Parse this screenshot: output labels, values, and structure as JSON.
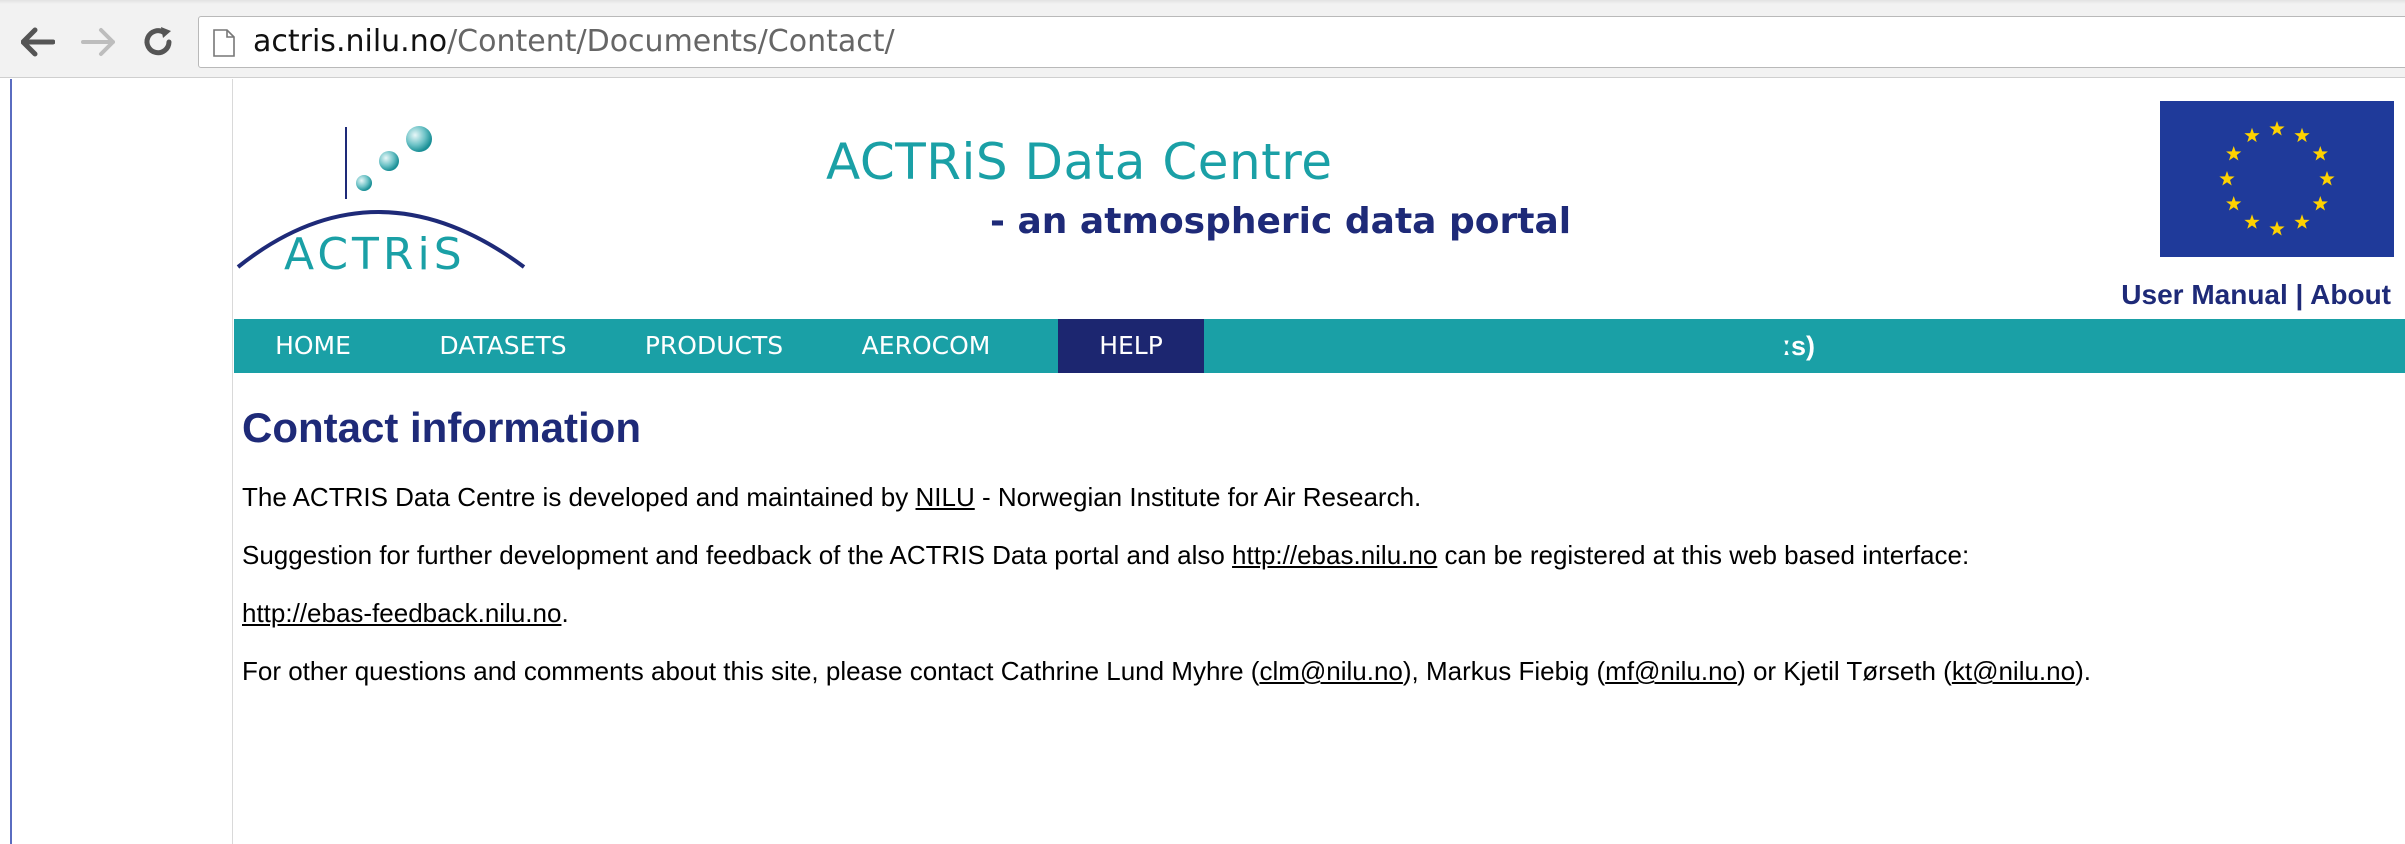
{
  "browser": {
    "url_host": "actris.nilu.no",
    "url_path": "/Content/Documents/Contact/",
    "back_icon": "arrow-left-icon",
    "forward_icon": "arrow-right-icon",
    "reload_icon": "reload-icon",
    "page_icon": "page-icon"
  },
  "header": {
    "logo_text": "ACTRiS",
    "title": "ACTRiS Data Centre",
    "subtitle": "- an atmospheric data portal",
    "links": {
      "user_manual": "User Manual",
      "separator": " | ",
      "about": "About"
    }
  },
  "nav": {
    "items": [
      {
        "label": "HOME",
        "active": false
      },
      {
        "label": "DATASETS",
        "active": false
      },
      {
        "label": "PRODUCTS",
        "active": false
      },
      {
        "label": "AEROCOM",
        "active": false
      },
      {
        "label": "HELP",
        "active": true
      }
    ],
    "trailing_text": "ːs)"
  },
  "main": {
    "heading": "Contact information",
    "p1": {
      "before": "The ACTRIS Data Centre is developed and maintained by ",
      "link": "NILU",
      "after": " - Norwegian Institute for Air Research."
    },
    "p2": {
      "before": "Suggestion for further development and feedback of the ACTRIS Data portal and also ",
      "link": "http://ebas.nilu.no",
      "after": " can be registered at this web based interface:"
    },
    "p3": {
      "link": "http://ebas-feedback.nilu.no",
      "after": "."
    },
    "p4": {
      "t1": "For other questions and comments about this site, please contact Cathrine Lund Myhre (",
      "link1": "clm@nilu.no",
      "t2": "), Markus Fiebig (",
      "link2": "mf@nilu.no",
      "t3": ") or Kjetil Tørseth (",
      "link3": "kt@nilu.no",
      "t4": ")."
    }
  },
  "colors": {
    "teal": "#1aa0a6",
    "navy": "#1e2a78",
    "nav_active": "#1c2670",
    "eu_blue": "#1f3a9a",
    "eu_star": "#ffd200"
  }
}
